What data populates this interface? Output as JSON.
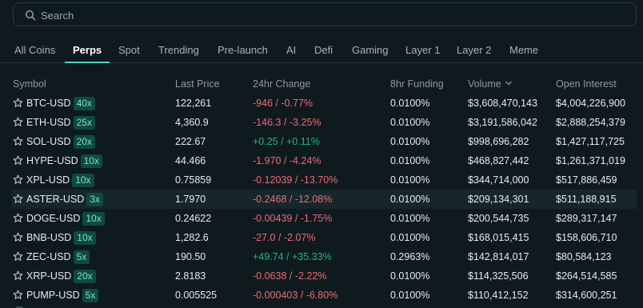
{
  "search": {
    "placeholder": "Search"
  },
  "tabs": [
    {
      "label": "All Coins"
    },
    {
      "label": "Perps"
    },
    {
      "label": "Spot"
    },
    {
      "label": "Trending"
    },
    {
      "label": "Pre-launch"
    },
    {
      "label": "AI"
    },
    {
      "label": "Defi"
    },
    {
      "label": "Gaming"
    },
    {
      "label": "Layer 1"
    },
    {
      "label": "Layer 2"
    },
    {
      "label": "Meme"
    }
  ],
  "active_tab": "Perps",
  "columns": {
    "symbol": "Symbol",
    "last_price": "Last Price",
    "change": "24hr Change",
    "funding": "8hr Funding",
    "volume": "Volume",
    "open_interest": "Open Interest"
  },
  "rows": [
    {
      "symbol": "BTC-USD",
      "leverage": "40x",
      "price": "122,261",
      "change": "-946 / -0.77%",
      "dir": "neg",
      "funding": "0.0100%",
      "volume": "$3,608,470,143",
      "oi": "$4,004,226,900"
    },
    {
      "symbol": "ETH-USD",
      "leverage": "25x",
      "price": "4,360.9",
      "change": "-146.3 / -3.25%",
      "dir": "neg",
      "funding": "0.0100%",
      "volume": "$3,191,586,042",
      "oi": "$2,888,254,379"
    },
    {
      "symbol": "SOL-USD",
      "leverage": "20x",
      "price": "222.67",
      "change": "+0.25 / +0.11%",
      "dir": "pos",
      "funding": "0.0100%",
      "volume": "$998,696,282",
      "oi": "$1,427,117,725"
    },
    {
      "symbol": "HYPE-USD",
      "leverage": "10x",
      "price": "44.466",
      "change": "-1.970 / -4.24%",
      "dir": "neg",
      "funding": "0.0100%",
      "volume": "$468,827,442",
      "oi": "$1,261,371,019"
    },
    {
      "symbol": "XPL-USD",
      "leverage": "10x",
      "price": "0.75859",
      "change": "-0.12039 / -13.70%",
      "dir": "neg",
      "funding": "0.0100%",
      "volume": "$344,714,000",
      "oi": "$517,886,459"
    },
    {
      "symbol": "ASTER-USD",
      "leverage": "3x",
      "price": "1.7970",
      "change": "-0.2468 / -12.08%",
      "dir": "neg",
      "funding": "0.0100%",
      "volume": "$209,134,301",
      "oi": "$511,188,915"
    },
    {
      "symbol": "DOGE-USD",
      "leverage": "10x",
      "price": "0.24622",
      "change": "-0.00439 / -1.75%",
      "dir": "neg",
      "funding": "0.0100%",
      "volume": "$200,544,735",
      "oi": "$289,317,147"
    },
    {
      "symbol": "BNB-USD",
      "leverage": "10x",
      "price": "1,282.6",
      "change": "-27.0 / -2.07%",
      "dir": "neg",
      "funding": "0.0100%",
      "volume": "$168,015,415",
      "oi": "$158,606,710"
    },
    {
      "symbol": "ZEC-USD",
      "leverage": "5x",
      "price": "190.50",
      "change": "+49.74 / +35.33%",
      "dir": "pos",
      "funding": "0.2963%",
      "volume": "$142,814,017",
      "oi": "$80,584,123"
    },
    {
      "symbol": "XRP-USD",
      "leverage": "20x",
      "price": "2.8183",
      "change": "-0.0638 / -2.22%",
      "dir": "neg",
      "funding": "0.0100%",
      "volume": "$114,325,506",
      "oi": "$264,514,585"
    },
    {
      "symbol": "PUMP-USD",
      "leverage": "5x",
      "price": "0.005525",
      "change": "-0.000403 / -6.80%",
      "dir": "neg",
      "funding": "0.0100%",
      "volume": "$110,412,152",
      "oi": "$314,600,251"
    }
  ],
  "colors": {
    "positive": "#1fb97e",
    "negative": "#ed6b73",
    "accent": "#50d2c1",
    "background": "#0f1a1f"
  },
  "icons": {
    "search": "search-icon",
    "favorite": "star-outline-icon",
    "sort": "chevron-down-icon"
  }
}
